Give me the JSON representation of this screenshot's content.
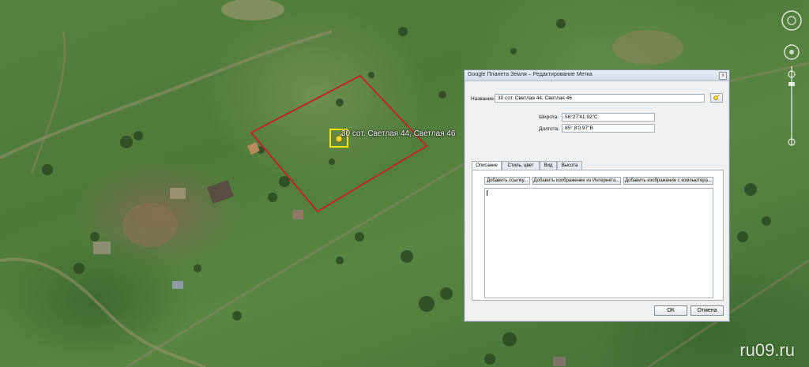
{
  "map": {
    "placemark_label": "30 сот. Светлая 44, Светлая 46",
    "watermark": "ru09.ru"
  },
  "dialog": {
    "title": "Google Планета Земля – Редактирование Метка",
    "close_glyph": "x",
    "name_label": "Название:",
    "name_value": "30 сот. Светлая 44, Светлая 46",
    "lat_label": "Широта:",
    "lat_value": "56°27'41.92\"С",
    "lon_label": "Долгота:",
    "lon_value": "85° 8'0.97\"В",
    "tabs": [
      {
        "label": "Описание"
      },
      {
        "label": "Стиль, цвет"
      },
      {
        "label": "Вид"
      },
      {
        "label": "Высота"
      }
    ],
    "panel_buttons": [
      {
        "label": "Добавить ссылку..."
      },
      {
        "label": "Добавить изображение из Интернета..."
      },
      {
        "label": "Добавить изображение с компьютера..."
      }
    ],
    "ok_label": "ОК",
    "cancel_label": "Отмена"
  },
  "colors": {
    "boundary": "#c0242a",
    "placemark_frame": "#ffe600",
    "pushpin": "#f2d52a"
  }
}
